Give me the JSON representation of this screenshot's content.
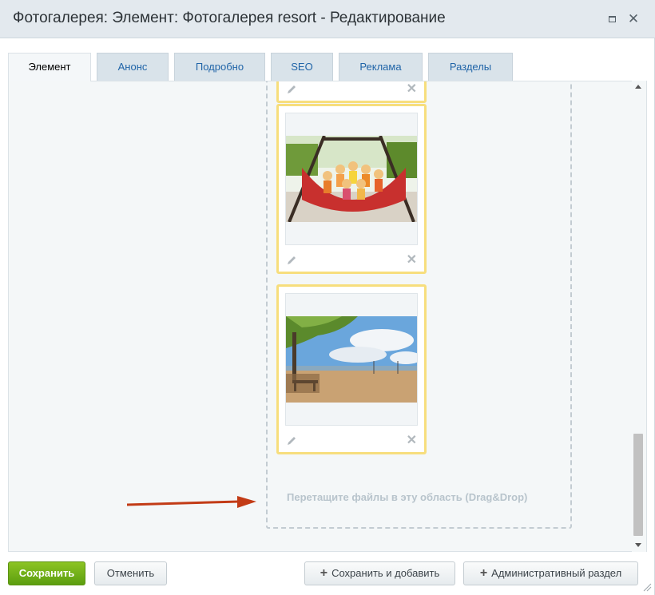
{
  "window": {
    "title": "Фотогалерея: Элемент: Фотогалерея resort - Редактирование",
    "maximize_icon": "maximize-icon",
    "close_icon": "close-icon",
    "close_glyph": "✕"
  },
  "tabs": [
    {
      "label": "Элемент",
      "active": true
    },
    {
      "label": "Анонс"
    },
    {
      "label": "Подробно"
    },
    {
      "label": "SEO"
    },
    {
      "label": "Реклама"
    },
    {
      "label": "Разделы"
    }
  ],
  "gallery": {
    "cards": [
      {
        "image": "partial-photo",
        "edit_icon": "pencil-icon",
        "delete_icon": "close-icon"
      },
      {
        "image": "children-in-hammock-photo",
        "edit_icon": "pencil-icon",
        "delete_icon": "close-icon"
      },
      {
        "image": "beach-with-picnic-tables-photo",
        "edit_icon": "pencil-icon",
        "delete_icon": "close-icon"
      }
    ],
    "delete_glyph": "✕",
    "drop_hint": "Перетащите файлы в эту область (Drag&Drop)",
    "annotation_arrow_color": "#c23b16"
  },
  "footer": {
    "save": "Сохранить",
    "cancel": "Отменить",
    "save_add": "Сохранить и добавить",
    "admin_section": "Административный раздел",
    "plus_glyph": "+"
  },
  "colors": {
    "accent_green": "#6aab15",
    "card_border": "#f7de7d",
    "tab_text": "#2165a8"
  }
}
